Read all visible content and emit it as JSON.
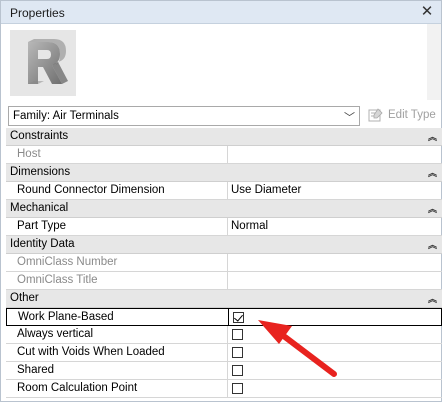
{
  "window": {
    "title": "Properties",
    "close_glyph": "✕"
  },
  "type_selector": {
    "value": "Family: Air Terminals",
    "edit_type_label": "Edit Type"
  },
  "groups": {
    "constraints": "Constraints",
    "dimensions": "Dimensions",
    "mechanical": "Mechanical",
    "identity": "Identity Data",
    "other": "Other"
  },
  "params": {
    "host": {
      "name": "Host",
      "value": ""
    },
    "round_connector": {
      "name": "Round Connector Dimension",
      "value": "Use Diameter"
    },
    "part_type": {
      "name": "Part Type",
      "value": "Normal"
    },
    "omniclass_number": {
      "name": "OmniClass Number",
      "value": ""
    },
    "omniclass_title": {
      "name": "OmniClass Title",
      "value": ""
    },
    "work_plane_based": {
      "name": "Work Plane-Based",
      "checked": true
    },
    "always_vertical": {
      "name": "Always vertical",
      "checked": false
    },
    "cut_with_voids": {
      "name": "Cut with Voids When Loaded",
      "checked": false
    },
    "shared": {
      "name": "Shared",
      "checked": false
    },
    "room_calc_point": {
      "name": "Room Calculation Point",
      "checked": false
    }
  },
  "colors": {
    "annotation_arrow": "#e8231f",
    "group_header": "#e7e7e7",
    "title_bar": "#dfe8f3"
  },
  "icons": [
    "revit-logo-icon",
    "chevron-down-icon",
    "edit-type-icon",
    "collapse-icon",
    "close-icon"
  ]
}
